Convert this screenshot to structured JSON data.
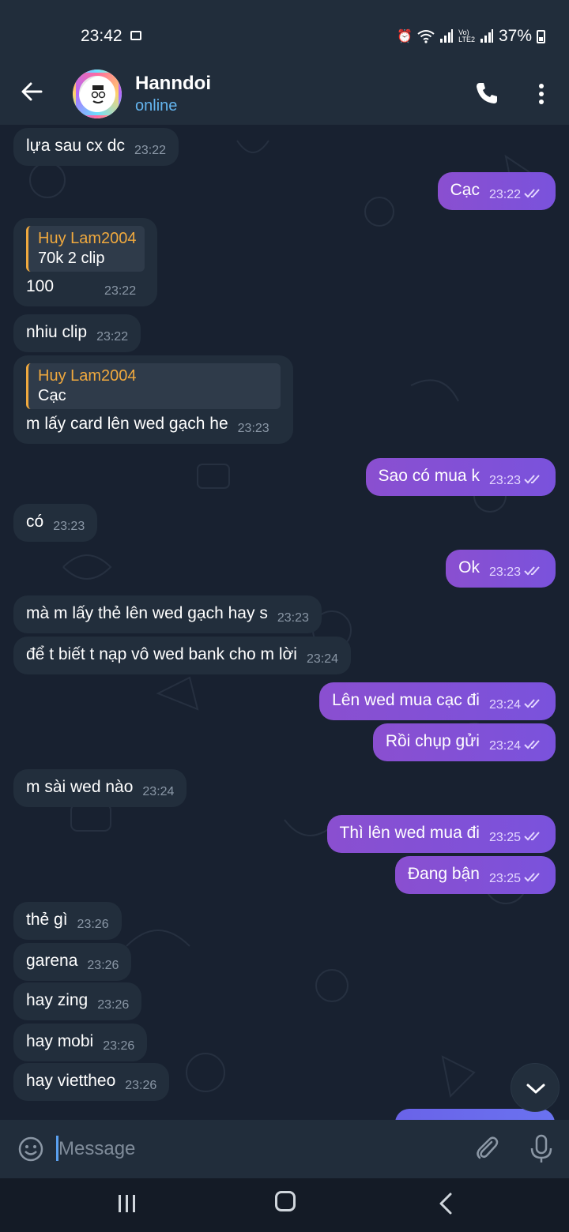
{
  "status_bar": {
    "time": "23:42",
    "battery": "37%",
    "icons": [
      "image-icon",
      "alarm-icon",
      "wifi-icon",
      "signal-icon",
      "volte-icon",
      "signal-icon",
      "battery-icon"
    ]
  },
  "header": {
    "name": "Hanndoi",
    "status": "online"
  },
  "messages": [
    {
      "dir": "in",
      "text": "lựa sau cx dc",
      "time": "23:22"
    },
    {
      "dir": "out",
      "text": "Cạc",
      "time": "23:22"
    },
    {
      "dir": "in",
      "reply_name": "Huy Lam2004",
      "reply_text": "70k 2 clip",
      "text": "100",
      "time": "23:22"
    },
    {
      "dir": "in",
      "text": "nhiu clip",
      "time": "23:22"
    },
    {
      "dir": "in",
      "reply_name": "Huy Lam2004",
      "reply_text": "Cạc",
      "text": "m lấy card lên wed gạch he",
      "time": "23:23"
    },
    {
      "dir": "out",
      "text": "Sao có mua k",
      "time": "23:23"
    },
    {
      "dir": "in",
      "text": "có",
      "time": "23:23"
    },
    {
      "dir": "out",
      "text": "Ok",
      "time": "23:23"
    },
    {
      "dir": "in",
      "text": "mà m lấy thẻ lên wed gạch hay s",
      "time": "23:23"
    },
    {
      "dir": "in",
      "text": "để t biết t nạp vô wed bank cho m lời",
      "time": "23:24"
    },
    {
      "dir": "out",
      "text": "Lên wed mua cạc đi",
      "time": "23:24"
    },
    {
      "dir": "out",
      "text": "Rồi chụp gửi",
      "time": "23:24"
    },
    {
      "dir": "in",
      "text": "m sài wed nào",
      "time": "23:24"
    },
    {
      "dir": "out",
      "text": "Thì lên wed mua đi",
      "time": "23:25"
    },
    {
      "dir": "out",
      "text": "Đang bận",
      "time": "23:25"
    },
    {
      "dir": "in",
      "text": "thẻ gì",
      "time": "23:26"
    },
    {
      "dir": "in",
      "text": "garena",
      "time": "23:26"
    },
    {
      "dir": "in",
      "text": "hay zing",
      "time": "23:26"
    },
    {
      "dir": "in",
      "text": "hay mobi",
      "time": "23:26"
    },
    {
      "dir": "in",
      "text": "hay viettheo",
      "time": "23:26"
    }
  ],
  "input": {
    "placeholder": "Message"
  },
  "colors": {
    "outgoing_bubble": "#8a4fd0",
    "incoming_bubble": "#222e3c",
    "reply_accent": "#f0a93e",
    "online": "#64b5ef"
  }
}
